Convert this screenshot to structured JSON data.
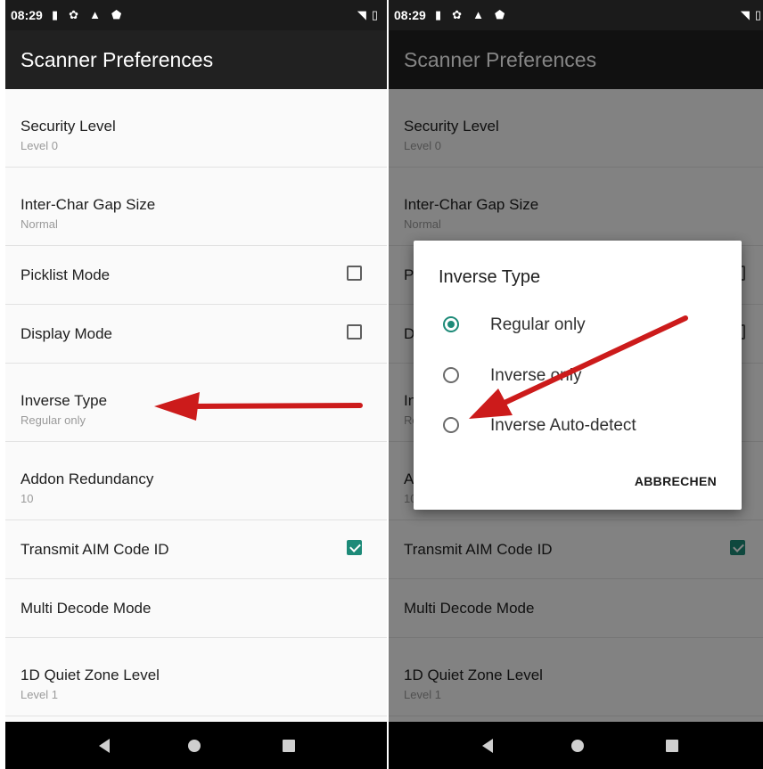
{
  "status_bar": {
    "time": "08:29",
    "icons": [
      "battery-saver-icon",
      "gear-icon",
      "warning-icon",
      "shield-icon"
    ],
    "right_icons": [
      "wifi-icon",
      "battery-icon"
    ]
  },
  "app_bar": {
    "title": "Scanner Preferences"
  },
  "settings": [
    {
      "label": "Security Level",
      "value": "Level 0"
    },
    {
      "label": "Inter-Char Gap Size",
      "value": "Normal"
    },
    {
      "label": "Picklist Mode",
      "checked": false
    },
    {
      "label": "Display Mode",
      "checked": false
    },
    {
      "label": "Inverse Type",
      "value": "Regular only"
    },
    {
      "label": "Addon Redundancy",
      "value": "10"
    },
    {
      "label": "Transmit AIM Code ID",
      "checked": true
    },
    {
      "label": "Multi Decode Mode"
    },
    {
      "label": "1D Quiet Zone Level",
      "value": "Level 1"
    }
  ],
  "dialog": {
    "title": "Inverse Type",
    "options": [
      "Regular only",
      "Inverse only",
      "Inverse Auto-detect"
    ],
    "selected_index": 0,
    "cancel_label": "ABBRECHEN"
  },
  "colors": {
    "accent": "#1d8a78",
    "app_bar": "#212121",
    "status_bar": "#1b1b1b",
    "annotation_arrow": "#cc1b1b"
  }
}
